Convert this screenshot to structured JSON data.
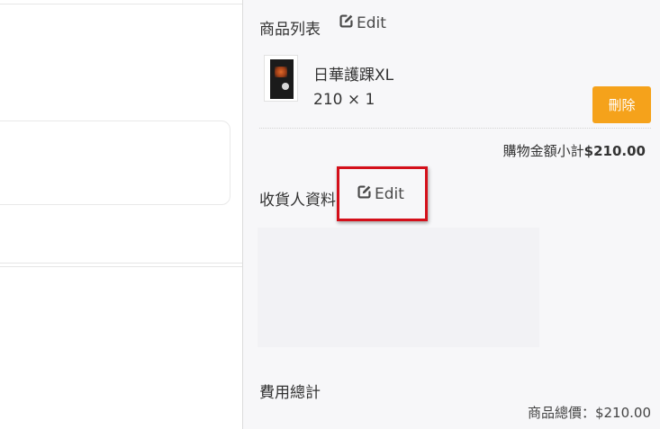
{
  "cart": {
    "title": "商品列表",
    "edit_label": "Edit",
    "items": [
      {
        "name": "日華護踝XL",
        "quantity_text": "210 × 1",
        "delete_label": "刪除",
        "image": "ankle-brace-product-image"
      }
    ],
    "subtotal_label": "購物金額小計",
    "subtotal_value": "$210.00"
  },
  "recipient": {
    "title": "收貨人資料",
    "edit_label": "Edit"
  },
  "summary": {
    "title": "費用總計",
    "total_label": "商品總價：",
    "total_value": "$210.00"
  },
  "colors": {
    "accent_orange": "#f5a21b",
    "highlight_red": "#d40f1a",
    "panel_bg": "#f7f7f9"
  },
  "icons": {
    "edit": "edit-square-pen-icon"
  }
}
